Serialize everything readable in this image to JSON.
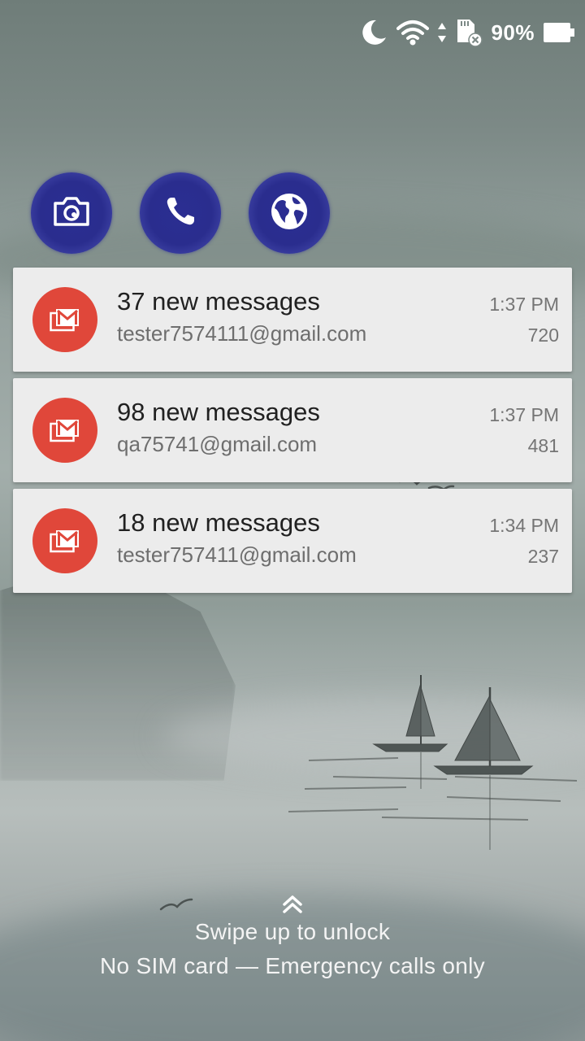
{
  "status_bar": {
    "icons": [
      "moon-icon",
      "wifi-icon",
      "data-arrows-icon",
      "sd-card-icon",
      "battery-icon"
    ],
    "battery_percent": "90%"
  },
  "shortcuts": [
    {
      "icon": "camera-icon"
    },
    {
      "icon": "phone-icon"
    },
    {
      "icon": "globe-icon"
    }
  ],
  "notifications": [
    {
      "title": "37 new messages",
      "account": "tester7574111@gmail.com",
      "time": "1:37 PM",
      "count": "720",
      "icon": "gmail-icon"
    },
    {
      "title": "98 new messages",
      "account": "qa75741@gmail.com",
      "time": "1:37 PM",
      "count": "481",
      "icon": "gmail-icon"
    },
    {
      "title": "18 new messages",
      "account": "tester757411@gmail.com",
      "time": "1:34 PM",
      "count": "237",
      "icon": "gmail-icon"
    }
  ],
  "lock": {
    "swipe_text": "Swipe up to unlock",
    "sim_text": "No SIM card — Emergency calls only"
  },
  "colors": {
    "shortcut_bg": "#2b2e92",
    "gmail_red": "#e0473a",
    "notification_bg": "#ececec"
  }
}
